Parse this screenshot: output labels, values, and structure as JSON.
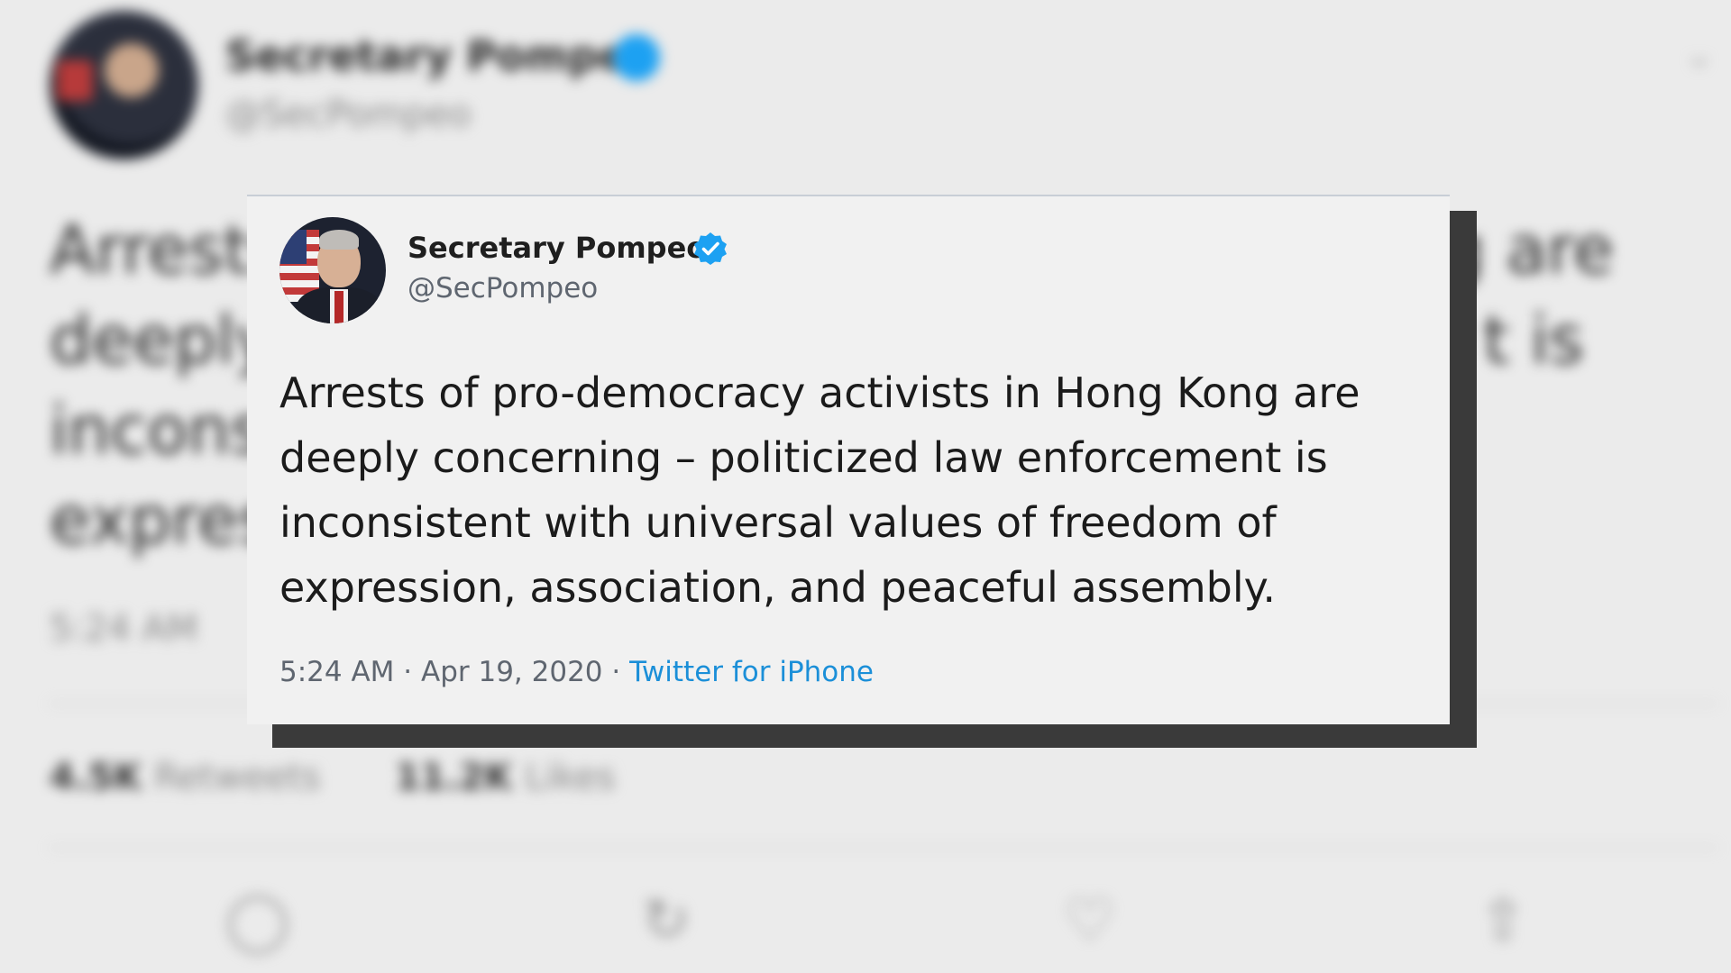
{
  "tweet": {
    "author_name": "Secretary Pompeo",
    "handle": "@SecPompeo",
    "verified": true,
    "text": "Arrests of pro-democracy activists in Hong Kong are deeply concerning – politicized law enforcement is inconsistent with universal values of freedom of expression, association, and peaceful assembly.",
    "time": "5:24 AM",
    "date": "Apr 19, 2020",
    "separator": "·",
    "source": "Twitter for iPhone"
  },
  "background_tweet": {
    "author_name": "Secretary Pompeo",
    "handle": "@SecPompeo",
    "line1_left": "Arrests",
    "line2_left": "deeply",
    "line3_left": "inconsi",
    "line4_left": "express",
    "line1_right": "g are",
    "line2_right": "t is",
    "time": "5:24 AM",
    "retweets_count": "4.5K",
    "retweets_label": "Retweets",
    "likes_count": "11.2K",
    "likes_label": "Likes"
  },
  "icons": {
    "verified": "verified-badge-icon",
    "reply": "reply-icon",
    "retweet": "retweet-icon",
    "like": "heart-icon",
    "share": "share-icon",
    "caret": "chevron-down-icon"
  },
  "colors": {
    "verified_blue": "#1da1f2",
    "source_link": "#1b8fd8",
    "background": "#ebebeb",
    "card": "#f1f1f1"
  }
}
